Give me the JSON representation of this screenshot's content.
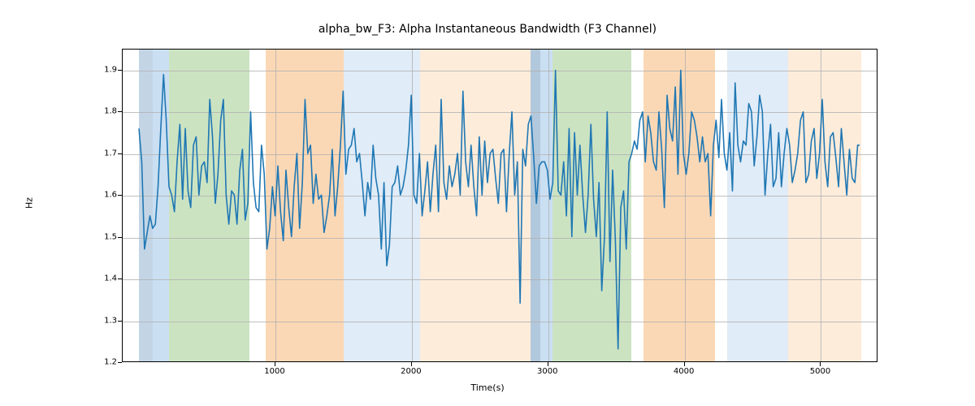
{
  "chart_data": {
    "type": "line",
    "title": "alpha_bw_F3: Alpha Instantaneous Bandwidth (F3 Channel)",
    "xlabel": "Time(s)",
    "ylabel": "Hz",
    "xlim": [
      -120,
      5420
    ],
    "ylim": [
      1.2,
      1.95
    ],
    "xticks": [
      1000,
      2000,
      3000,
      4000,
      5000
    ],
    "yticks": [
      1.2,
      1.3,
      1.4,
      1.5,
      1.6,
      1.7,
      1.8,
      1.9
    ],
    "grid": true,
    "line_color": "#1f77b4",
    "bands": [
      {
        "x0": 0,
        "x1": 100,
        "color": "#b8cee0",
        "alpha": 0.85
      },
      {
        "x0": 100,
        "x1": 220,
        "color": "#9fc5e8",
        "alpha": 0.55
      },
      {
        "x0": 220,
        "x1": 810,
        "color": "#b6d7a8",
        "alpha": 0.7
      },
      {
        "x0": 930,
        "x1": 1500,
        "color": "#f9cb9c",
        "alpha": 0.75
      },
      {
        "x0": 1500,
        "x1": 2060,
        "color": "#cfe2f3",
        "alpha": 0.65
      },
      {
        "x0": 2060,
        "x1": 2870,
        "color": "#fce5cd",
        "alpha": 0.75
      },
      {
        "x0": 2870,
        "x1": 2940,
        "color": "#a4bed6",
        "alpha": 0.85
      },
      {
        "x0": 2940,
        "x1": 3030,
        "color": "#9fc5e8",
        "alpha": 0.55
      },
      {
        "x0": 3030,
        "x1": 3610,
        "color": "#b6d7a8",
        "alpha": 0.7
      },
      {
        "x0": 3700,
        "x1": 4220,
        "color": "#f9cb9c",
        "alpha": 0.75
      },
      {
        "x0": 4310,
        "x1": 4760,
        "color": "#cfe2f3",
        "alpha": 0.65
      },
      {
        "x0": 4760,
        "x1": 5295,
        "color": "#fce5cd",
        "alpha": 0.75
      }
    ],
    "series": [
      {
        "name": "alpha_bw_F3",
        "x": [
          0,
          20,
          40,
          60,
          80,
          100,
          120,
          140,
          160,
          180,
          200,
          220,
          240,
          260,
          280,
          300,
          320,
          340,
          360,
          380,
          400,
          420,
          440,
          460,
          480,
          500,
          520,
          540,
          560,
          580,
          600,
          620,
          640,
          660,
          680,
          700,
          720,
          740,
          760,
          780,
          800,
          820,
          840,
          860,
          880,
          900,
          920,
          940,
          960,
          980,
          1000,
          1020,
          1040,
          1060,
          1080,
          1100,
          1120,
          1140,
          1160,
          1180,
          1200,
          1220,
          1240,
          1260,
          1280,
          1300,
          1320,
          1340,
          1360,
          1380,
          1400,
          1420,
          1440,
          1460,
          1480,
          1500,
          1520,
          1540,
          1560,
          1580,
          1600,
          1620,
          1640,
          1660,
          1680,
          1700,
          1720,
          1740,
          1760,
          1780,
          1800,
          1820,
          1840,
          1860,
          1880,
          1900,
          1920,
          1940,
          1960,
          1980,
          2000,
          2020,
          2040,
          2060,
          2080,
          2100,
          2120,
          2140,
          2160,
          2180,
          2200,
          2220,
          2240,
          2260,
          2280,
          2300,
          2320,
          2340,
          2360,
          2380,
          2400,
          2420,
          2440,
          2460,
          2480,
          2500,
          2520,
          2540,
          2560,
          2580,
          2600,
          2620,
          2640,
          2660,
          2680,
          2700,
          2720,
          2740,
          2760,
          2780,
          2800,
          2820,
          2840,
          2860,
          2880,
          2900,
          2920,
          2940,
          2960,
          2980,
          3000,
          3020,
          3040,
          3060,
          3080,
          3100,
          3120,
          3140,
          3160,
          3180,
          3200,
          3220,
          3240,
          3260,
          3280,
          3300,
          3320,
          3340,
          3360,
          3380,
          3400,
          3420,
          3440,
          3460,
          3480,
          3500,
          3520,
          3540,
          3560,
          3580,
          3600,
          3620,
          3640,
          3660,
          3680,
          3700,
          3720,
          3740,
          3760,
          3780,
          3800,
          3820,
          3840,
          3860,
          3880,
          3900,
          3920,
          3940,
          3960,
          3980,
          4000,
          4020,
          4040,
          4060,
          4080,
          4100,
          4120,
          4140,
          4160,
          4180,
          4200,
          4220,
          4240,
          4260,
          4280,
          4300,
          4320,
          4340,
          4360,
          4380,
          4400,
          4420,
          4440,
          4460,
          4480,
          4500,
          4520,
          4540,
          4560,
          4580,
          4600,
          4620,
          4640,
          4660,
          4680,
          4700,
          4720,
          4740,
          4760,
          4780,
          4800,
          4820,
          4840,
          4860,
          4880,
          4900,
          4920,
          4940,
          4960,
          4980,
          5000,
          5020,
          5040,
          5060,
          5080,
          5100,
          5120,
          5140,
          5160,
          5180,
          5200,
          5220,
          5240,
          5260,
          5280,
          5295
        ],
        "y": [
          1.76,
          1.68,
          1.47,
          1.51,
          1.55,
          1.52,
          1.53,
          1.62,
          1.76,
          1.89,
          1.78,
          1.62,
          1.6,
          1.56,
          1.68,
          1.77,
          1.59,
          1.76,
          1.61,
          1.57,
          1.72,
          1.74,
          1.6,
          1.67,
          1.68,
          1.63,
          1.83,
          1.74,
          1.58,
          1.65,
          1.78,
          1.83,
          1.6,
          1.53,
          1.61,
          1.6,
          1.53,
          1.66,
          1.71,
          1.54,
          1.58,
          1.8,
          1.63,
          1.57,
          1.56,
          1.72,
          1.65,
          1.47,
          1.52,
          1.62,
          1.55,
          1.67,
          1.56,
          1.49,
          1.66,
          1.57,
          1.5,
          1.62,
          1.7,
          1.52,
          1.63,
          1.83,
          1.7,
          1.72,
          1.58,
          1.65,
          1.59,
          1.6,
          1.51,
          1.55,
          1.6,
          1.71,
          1.55,
          1.62,
          1.72,
          1.85,
          1.65,
          1.71,
          1.72,
          1.76,
          1.68,
          1.7,
          1.63,
          1.55,
          1.63,
          1.59,
          1.72,
          1.64,
          1.6,
          1.47,
          1.63,
          1.43,
          1.48,
          1.62,
          1.63,
          1.67,
          1.6,
          1.62,
          1.66,
          1.72,
          1.84,
          1.6,
          1.58,
          1.7,
          1.55,
          1.61,
          1.68,
          1.56,
          1.65,
          1.72,
          1.56,
          1.83,
          1.63,
          1.59,
          1.67,
          1.62,
          1.65,
          1.7,
          1.6,
          1.85,
          1.68,
          1.62,
          1.72,
          1.62,
          1.55,
          1.74,
          1.6,
          1.73,
          1.63,
          1.7,
          1.71,
          1.64,
          1.58,
          1.7,
          1.71,
          1.56,
          1.7,
          1.8,
          1.6,
          1.68,
          1.34,
          1.71,
          1.67,
          1.77,
          1.79,
          1.69,
          1.58,
          1.67,
          1.68,
          1.68,
          1.66,
          1.59,
          1.63,
          1.9,
          1.61,
          1.6,
          1.68,
          1.55,
          1.76,
          1.5,
          1.75,
          1.6,
          1.72,
          1.6,
          1.51,
          1.6,
          1.77,
          1.59,
          1.5,
          1.63,
          1.37,
          1.5,
          1.8,
          1.44,
          1.66,
          1.49,
          1.23,
          1.57,
          1.61,
          1.47,
          1.68,
          1.7,
          1.73,
          1.71,
          1.78,
          1.8,
          1.68,
          1.79,
          1.75,
          1.68,
          1.66,
          1.8,
          1.71,
          1.57,
          1.84,
          1.76,
          1.73,
          1.86,
          1.65,
          1.9,
          1.7,
          1.65,
          1.7,
          1.8,
          1.78,
          1.74,
          1.68,
          1.74,
          1.68,
          1.7,
          1.55,
          1.72,
          1.78,
          1.69,
          1.83,
          1.7,
          1.66,
          1.75,
          1.61,
          1.87,
          1.72,
          1.68,
          1.73,
          1.72,
          1.82,
          1.8,
          1.67,
          1.74,
          1.84,
          1.8,
          1.6,
          1.7,
          1.77,
          1.62,
          1.64,
          1.75,
          1.62,
          1.7,
          1.76,
          1.72,
          1.63,
          1.66,
          1.7,
          1.78,
          1.8,
          1.63,
          1.65,
          1.73,
          1.76,
          1.64,
          1.7,
          1.83,
          1.68,
          1.62,
          1.74,
          1.75,
          1.69,
          1.62,
          1.76,
          1.68,
          1.6,
          1.71,
          1.64,
          1.63,
          1.72,
          1.72
        ]
      }
    ]
  }
}
